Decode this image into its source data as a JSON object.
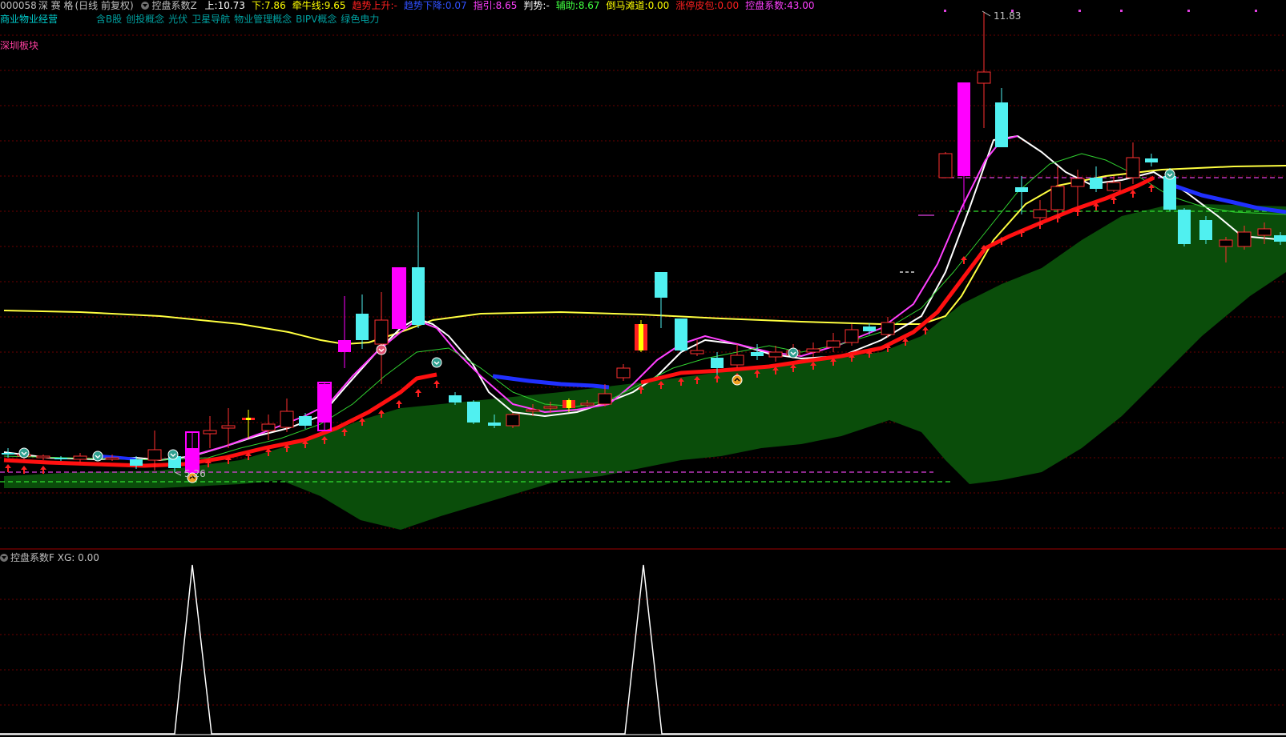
{
  "header": {
    "stock_code": "000058",
    "stock_name": "深 赛 格",
    "mode": "(日线 前复权)",
    "indicator_name": "控盘系数Z",
    "fields": [
      {
        "label": "上:",
        "value": "10.73",
        "color": "#ffffff"
      },
      {
        "label": "下:",
        "value": "7.86",
        "color": "#ffff00"
      },
      {
        "label": "牵牛线:",
        "value": "9.65",
        "color": "#ffff00"
      },
      {
        "label": "趋势上升:",
        "value": "-",
        "color": "#ff2020"
      },
      {
        "label": "趋势下降:",
        "value": "0.07",
        "color": "#3050ff"
      },
      {
        "label": "指引:",
        "value": "8.65",
        "color": "#ff40ff"
      },
      {
        "label": "判势:",
        "value": "-",
        "color": "#ffffff"
      },
      {
        "label": "辅助:",
        "value": "8.67",
        "color": "#40ff40"
      },
      {
        "label": "倒马滩道:",
        "value": "0.00",
        "color": "#ffff00"
      },
      {
        "label": "涨停皮包:",
        "value": "0.00",
        "color": "#ff2020"
      },
      {
        "label": "控盘系数:",
        "value": "43.00",
        "color": "#ff40ff"
      }
    ]
  },
  "industry": "商业物业经营",
  "concepts": [
    "含B股",
    "创投概念",
    "光伏",
    "卫星导航",
    "物业管理概念",
    "BIPV概念",
    "绿色电力"
  ],
  "board": "深圳板块",
  "chart_annotations": {
    "high_label": "11.83",
    "low_label": "5.26"
  },
  "sub_indicator": {
    "name": "控盘系数F",
    "field_label": "XG:",
    "field_value": "0.00"
  },
  "colors": {
    "up": "#ff3030",
    "down": "#50f0f0",
    "pink": "#ff00ff",
    "band": "#0a4d0a",
    "grid": "#6b0000",
    "ma_white": "#ffffff",
    "ma_yellow": "#ffff40",
    "ma_magenta": "#ff40ff",
    "ma_green": "#30d030",
    "ma_red": "#ff1010",
    "ma_blue": "#2030ff"
  },
  "icons": [
    "gear-icon",
    "arrow-up-icon",
    "signal-badge-icon"
  ]
}
